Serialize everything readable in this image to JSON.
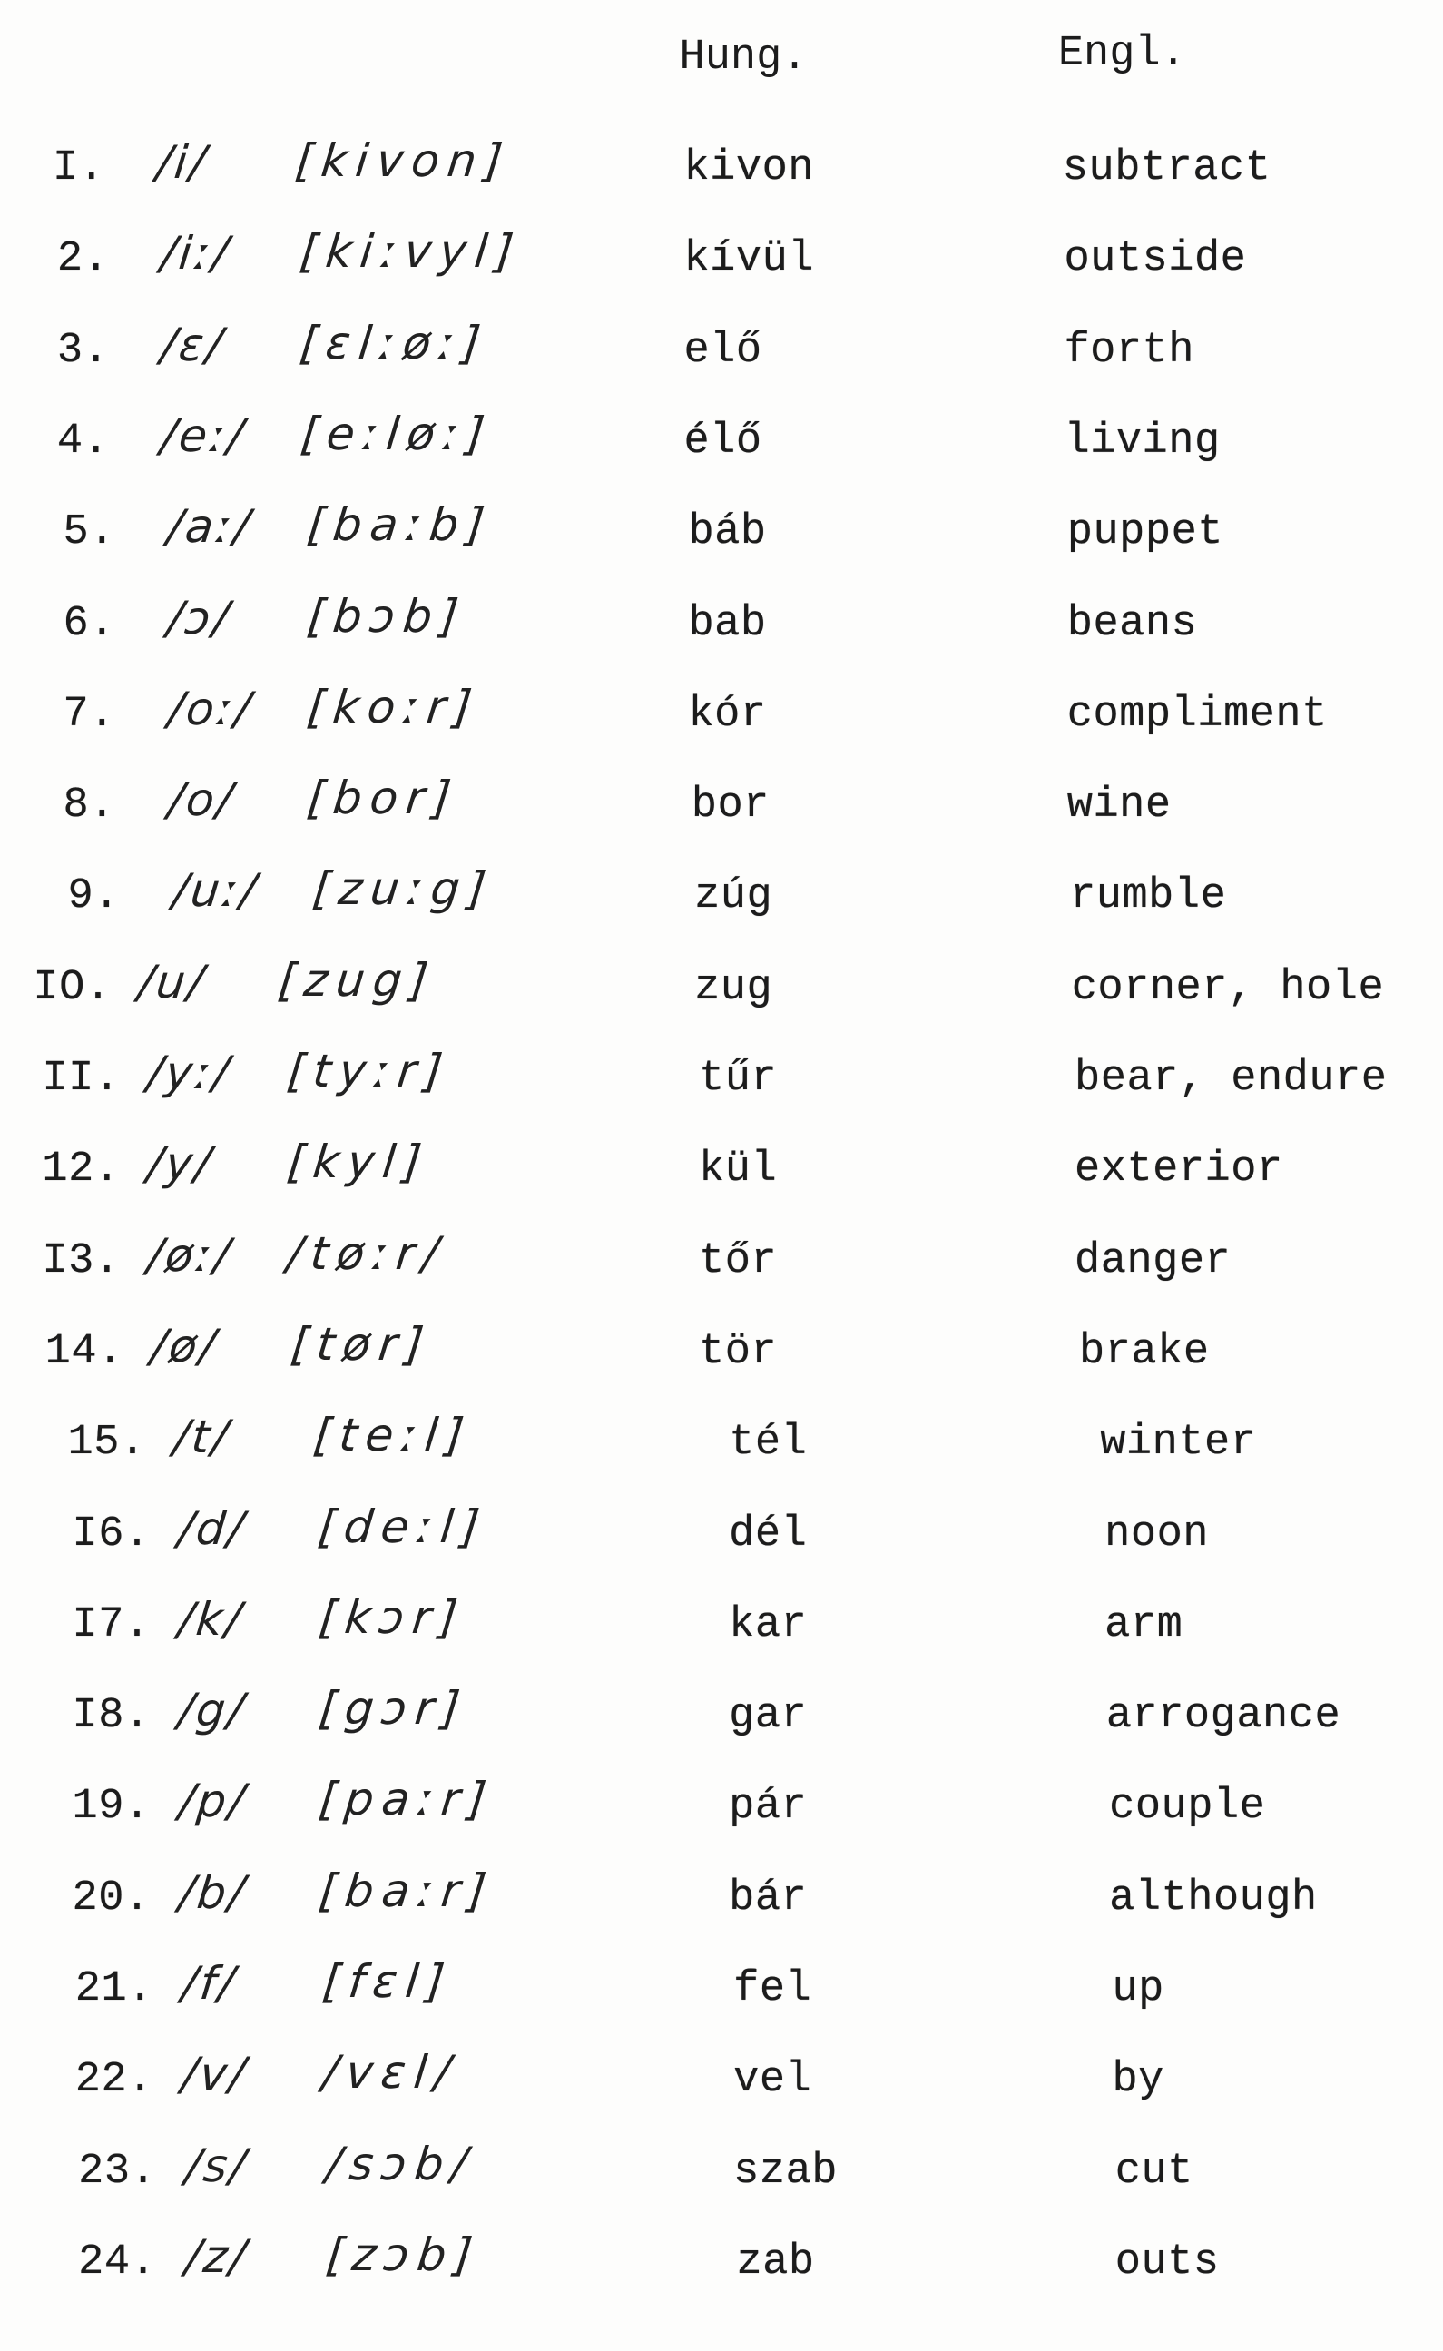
{
  "header": {
    "hungarian_label": "Hung.",
    "english_label": "Engl."
  },
  "rows": [
    {
      "number": "I.",
      "phoneme": "/i/",
      "transcription": "[kivon]",
      "hungarian": "kivon",
      "english": "subtract"
    },
    {
      "number": "2.",
      "phoneme": "/iː/",
      "transcription": "[kiːvyl]",
      "hungarian": "kívül",
      "english": "outside"
    },
    {
      "number": "3.",
      "phoneme": "/ɛ/",
      "transcription": "[ɛlːøː]",
      "hungarian": "elő",
      "english": "forth"
    },
    {
      "number": "4.",
      "phoneme": "/eː/",
      "transcription": "[eːløː]",
      "hungarian": "élő",
      "english": "living"
    },
    {
      "number": "5.",
      "phoneme": "/aː/",
      "transcription": "[baːb]",
      "hungarian": "báb",
      "english": "puppet"
    },
    {
      "number": "6.",
      "phoneme": "/ɔ/",
      "transcription": "[bɔb]",
      "hungarian": "bab",
      "english": "beans"
    },
    {
      "number": "7.",
      "phoneme": "/oː/",
      "transcription": "[koːr]",
      "hungarian": "kór",
      "english": "compliment"
    },
    {
      "number": "8.",
      "phoneme": "/o/",
      "transcription": "[bor]",
      "hungarian": "bor",
      "english": "wine"
    },
    {
      "number": "9.",
      "phoneme": "/uː/",
      "transcription": "[zuːg]",
      "hungarian": "zúg",
      "english": "rumble"
    },
    {
      "number": "IO.",
      "phoneme": "/u/",
      "transcription": "[zug]",
      "hungarian": "zug",
      "english": "corner, hole"
    },
    {
      "number": "II.",
      "phoneme": "/yː/",
      "transcription": "[tyːr]",
      "hungarian": "tűr",
      "english": "bear, endure"
    },
    {
      "number": "12.",
      "phoneme": "/y/",
      "transcription": "[kyl]",
      "hungarian": "kül",
      "english": "exterior"
    },
    {
      "number": "I3.",
      "phoneme": "/øː/",
      "transcription": "/tøːr/",
      "hungarian": "tőr",
      "english": "danger"
    },
    {
      "number": "14.",
      "phoneme": "/ø/",
      "transcription": "[tør]",
      "hungarian": "tör",
      "english": "brake"
    },
    {
      "number": "15.",
      "phoneme": "/t/",
      "transcription": "[teːl]",
      "hungarian": "tél",
      "english": "winter"
    },
    {
      "number": "I6.",
      "phoneme": "/d/",
      "transcription": "[deːl]",
      "hungarian": "dél",
      "english": "noon"
    },
    {
      "number": "I7.",
      "phoneme": "/k/",
      "transcription": "[kɔr]",
      "hungarian": "kar",
      "english": "arm"
    },
    {
      "number": "I8.",
      "phoneme": "/g/",
      "transcription": "[gɔr]",
      "hungarian": "gar",
      "english": "arrogance"
    },
    {
      "number": "19.",
      "phoneme": "/p/",
      "transcription": "[paːr]",
      "hungarian": "pár",
      "english": "couple"
    },
    {
      "number": "20.",
      "phoneme": "/b/",
      "transcription": "[baːr]",
      "hungarian": "bár",
      "english": "although"
    },
    {
      "number": "21.",
      "phoneme": "/f/",
      "transcription": "[fɛl]",
      "hungarian": "fel",
      "english": "up"
    },
    {
      "number": "22.",
      "phoneme": "/v/",
      "transcription": "/vɛl/",
      "hungarian": "vel",
      "english": "by"
    },
    {
      "number": "23.",
      "phoneme": "/s/",
      "transcription": "/sɔb/",
      "hungarian": "szab",
      "english": "cut"
    },
    {
      "number": "24.",
      "phoneme": "/z/",
      "transcription": "[zɔb]",
      "hungarian": "zab",
      "english": "outs"
    }
  ]
}
